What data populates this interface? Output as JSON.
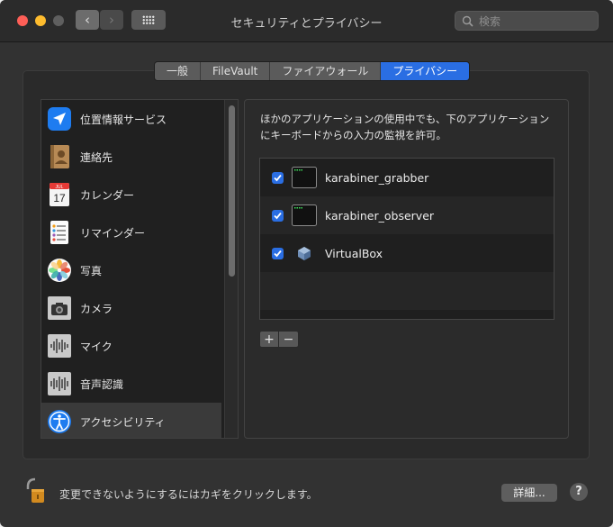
{
  "window": {
    "title": "セキュリティとプライバシー"
  },
  "toolbar": {
    "back_glyph": "‹",
    "forward_glyph": "›"
  },
  "search": {
    "placeholder": "検索",
    "value": ""
  },
  "tabs": [
    {
      "label": "一般",
      "active": false
    },
    {
      "label": "FileVault",
      "active": false
    },
    {
      "label": "ファイアウォール",
      "active": false
    },
    {
      "label": "プライバシー",
      "active": true
    }
  ],
  "sidebar": {
    "items": [
      {
        "label": "位置情報サービス",
        "icon": "location-arrow-icon"
      },
      {
        "label": "連絡先",
        "icon": "contacts-icon"
      },
      {
        "label": "カレンダー",
        "icon": "calendar-icon",
        "icon_month": "JUL",
        "icon_day": "17"
      },
      {
        "label": "リマインダー",
        "icon": "reminders-icon"
      },
      {
        "label": "写真",
        "icon": "photos-icon"
      },
      {
        "label": "カメラ",
        "icon": "camera-icon"
      },
      {
        "label": "マイク",
        "icon": "microphone-icon"
      },
      {
        "label": "音声認識",
        "icon": "speech-recognition-icon"
      },
      {
        "label": "アクセシビリティ",
        "icon": "accessibility-icon"
      }
    ]
  },
  "main": {
    "description": "ほかのアプリケーションの使用中でも、下のアプリケーションにキーボードからの入力の監視を許可。",
    "apps": [
      {
        "name": "karabiner_grabber",
        "checked": true,
        "icon": "terminal-icon"
      },
      {
        "name": "karabiner_observer",
        "checked": true,
        "icon": "terminal-icon"
      },
      {
        "name": "VirtualBox",
        "checked": true,
        "icon": "virtualbox-icon"
      }
    ],
    "add_label": "+",
    "remove_label": "−"
  },
  "footer": {
    "lock_text": "変更できないようにするにはカギをクリックします。",
    "advanced_label": "詳細...",
    "help_label": "?"
  },
  "colors": {
    "accent": "#2a6ee3",
    "background": "#323232"
  }
}
